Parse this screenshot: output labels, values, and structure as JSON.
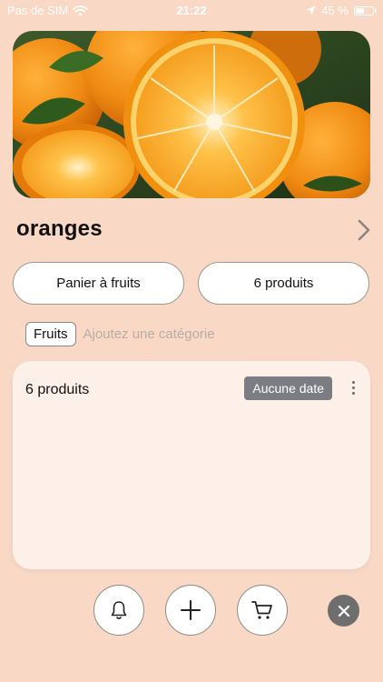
{
  "status": {
    "carrier": "Pas de SIM",
    "time": "21:22",
    "battery_text": "45 %",
    "battery_level": 0.45
  },
  "hero": {
    "icon": "orange-fruit-photo"
  },
  "item": {
    "title": "oranges"
  },
  "pills": {
    "left": "Panier à fruits",
    "right": "6 produits"
  },
  "tags": {
    "category": "Fruits",
    "add_hint": "Ajoutez une catégorie"
  },
  "card": {
    "count": "6 produits",
    "date_badge": "Aucune date"
  },
  "toolbar": {
    "icons": [
      "bell-icon",
      "plus-icon",
      "cart-icon",
      "close-icon"
    ]
  },
  "colors": {
    "background": "#f9d9c6",
    "card": "#fdf0e8",
    "badge": "#7b7d82",
    "close": "#6f6e6e"
  }
}
